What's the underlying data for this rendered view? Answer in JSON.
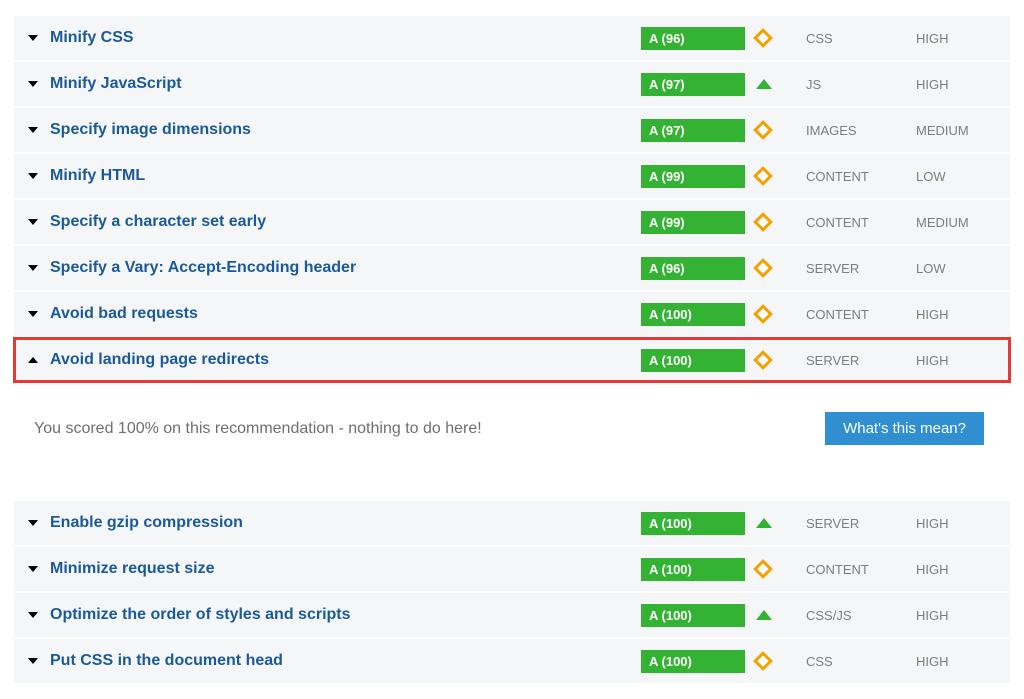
{
  "detail_message": "You scored 100% on this recommendation - nothing to do here!",
  "help_button_label": "What's this mean?",
  "rows": [
    {
      "title": "Minify CSS",
      "grade": "A (96)",
      "icon": "diamond",
      "type": "CSS",
      "priority": "HIGH",
      "expanded": false,
      "highlighted": false
    },
    {
      "title": "Minify JavaScript",
      "grade": "A (97)",
      "icon": "caret-up",
      "type": "JS",
      "priority": "HIGH",
      "expanded": false,
      "highlighted": false
    },
    {
      "title": "Specify image dimensions",
      "grade": "A (97)",
      "icon": "diamond",
      "type": "IMAGES",
      "priority": "MEDIUM",
      "expanded": false,
      "highlighted": false
    },
    {
      "title": "Minify HTML",
      "grade": "A (99)",
      "icon": "diamond",
      "type": "CONTENT",
      "priority": "LOW",
      "expanded": false,
      "highlighted": false
    },
    {
      "title": "Specify a character set early",
      "grade": "A (99)",
      "icon": "diamond",
      "type": "CONTENT",
      "priority": "MEDIUM",
      "expanded": false,
      "highlighted": false
    },
    {
      "title": "Specify a Vary: Accept-Encoding header",
      "grade": "A (96)",
      "icon": "diamond",
      "type": "SERVER",
      "priority": "LOW",
      "expanded": false,
      "highlighted": false
    },
    {
      "title": "Avoid bad requests",
      "grade": "A (100)",
      "icon": "diamond",
      "type": "CONTENT",
      "priority": "HIGH",
      "expanded": false,
      "highlighted": false
    },
    {
      "title": "Avoid landing page redirects",
      "grade": "A (100)",
      "icon": "diamond",
      "type": "SERVER",
      "priority": "HIGH",
      "expanded": true,
      "highlighted": true
    },
    {
      "spacer": true
    },
    {
      "title": "Enable gzip compression",
      "grade": "A (100)",
      "icon": "caret-up",
      "type": "SERVER",
      "priority": "HIGH",
      "expanded": false,
      "highlighted": false
    },
    {
      "title": "Minimize request size",
      "grade": "A (100)",
      "icon": "diamond",
      "type": "CONTENT",
      "priority": "HIGH",
      "expanded": false,
      "highlighted": false
    },
    {
      "title": "Optimize the order of styles and scripts",
      "grade": "A (100)",
      "icon": "caret-up",
      "type": "CSS/JS",
      "priority": "HIGH",
      "expanded": false,
      "highlighted": false
    },
    {
      "title": "Put CSS in the document head",
      "grade": "A (100)",
      "icon": "diamond",
      "type": "CSS",
      "priority": "HIGH",
      "expanded": false,
      "highlighted": false
    }
  ]
}
